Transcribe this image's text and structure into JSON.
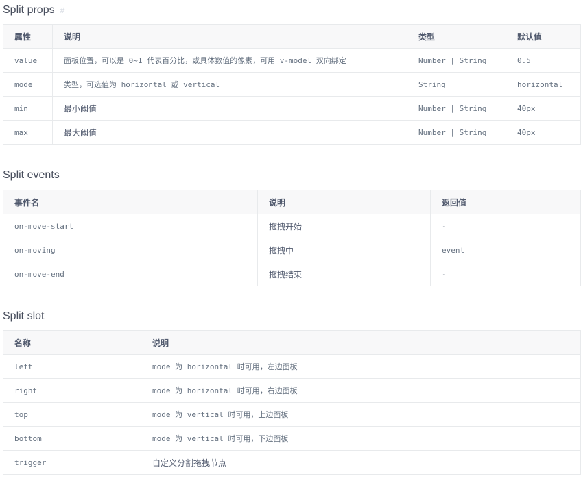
{
  "props": {
    "title": "Split props",
    "anchor": "#",
    "headers": [
      "属性",
      "说明",
      "类型",
      "默认值"
    ],
    "rows": [
      {
        "name": "value",
        "desc": "面板位置，可以是 0~1 代表百分比，或具体数值的像素，可用 v-model 双向绑定",
        "type": "Number | String",
        "default": "0.5"
      },
      {
        "name": "mode",
        "desc": "类型，可选值为 horizontal 或 vertical",
        "type": "String",
        "default": "horizontal"
      },
      {
        "name": "min",
        "desc": "最小阈值",
        "type": "Number | String",
        "default": "40px"
      },
      {
        "name": "max",
        "desc": "最大阈值",
        "type": "Number | String",
        "default": "40px"
      }
    ]
  },
  "events": {
    "title": "Split events",
    "headers": [
      "事件名",
      "说明",
      "返回值"
    ],
    "rows": [
      {
        "name": "on-move-start",
        "desc": "拖拽开始",
        "ret": "-"
      },
      {
        "name": "on-moving",
        "desc": "拖拽中",
        "ret": "event"
      },
      {
        "name": "on-move-end",
        "desc": "拖拽结束",
        "ret": "-"
      }
    ]
  },
  "slots": {
    "title": "Split slot",
    "headers": [
      "名称",
      "说明"
    ],
    "rows": [
      {
        "name": "left",
        "desc": "mode 为 horizontal 时可用，左边面板"
      },
      {
        "name": "right",
        "desc": "mode 为 horizontal 时可用，右边面板"
      },
      {
        "name": "top",
        "desc": "mode 为 vertical 时可用，上边面板"
      },
      {
        "name": "bottom",
        "desc": "mode 为 vertical 时可用，下边面板"
      },
      {
        "name": "trigger",
        "desc": "自定义分割拖拽节点"
      }
    ]
  }
}
